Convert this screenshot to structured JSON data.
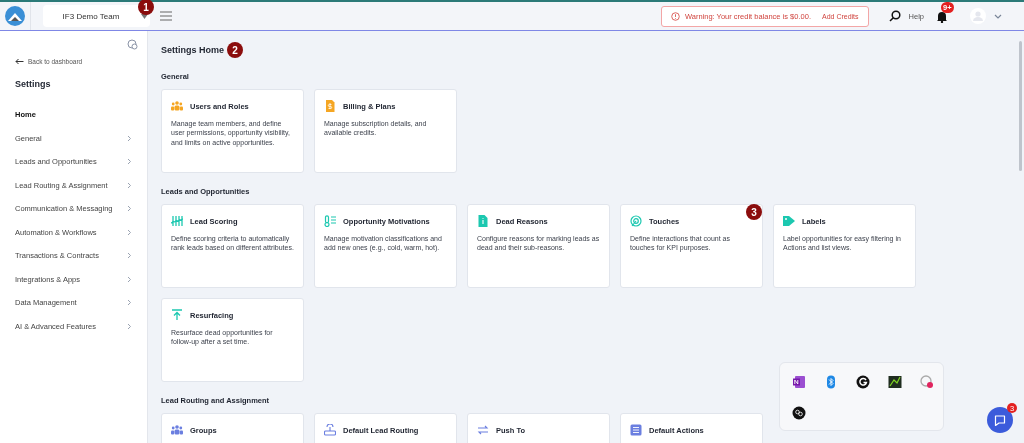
{
  "topbar": {
    "team": "IF3 Demo Team",
    "warning": "Warning: Your credit balance is $0.00.",
    "warning_action": "Add Credits",
    "help": "Help",
    "notification_count": "9+"
  },
  "sidebar": {
    "back": "Back to dashboard",
    "title": "Settings",
    "items": [
      {
        "label": "Home",
        "kind": "link",
        "selected": true
      },
      {
        "label": "General",
        "kind": "group",
        "selected": false
      },
      {
        "label": "Leads and Opportunities",
        "kind": "group",
        "selected": false
      },
      {
        "label": "Lead Routing & Assignment",
        "kind": "group",
        "selected": false
      },
      {
        "label": "Communication & Messaging",
        "kind": "group",
        "selected": false
      },
      {
        "label": "Automation & Workflows",
        "kind": "group",
        "selected": false
      },
      {
        "label": "Transactions & Contracts",
        "kind": "group",
        "selected": false
      },
      {
        "label": "Integrations & Apps",
        "kind": "group",
        "selected": false
      },
      {
        "label": "Data Management",
        "kind": "group",
        "selected": false
      },
      {
        "label": "AI & Advanced Features",
        "kind": "group",
        "selected": false
      }
    ]
  },
  "page_title": "Settings Home",
  "sections": [
    {
      "title": "General",
      "color": "#f5a623",
      "cards": [
        {
          "title": "Users and Roles",
          "kind": "users",
          "description": "Manage team members, and define user permissions, opportunity visibility, and limits on active opportunities."
        },
        {
          "title": "Billing & Plans",
          "kind": "bill",
          "description": "Manage subscription details, and available credits."
        }
      ]
    },
    {
      "title": "Leads and Opportunities",
      "color": "#1cc8b0",
      "cards": [
        {
          "title": "Lead Scoring",
          "kind": "tally",
          "description": "Define scoring criteria to automatically rank leads based on different attributes."
        },
        {
          "title": "Opportunity Motivations",
          "kind": "thermo",
          "description": "Manage motivation classifications and add new ones (e.g., cold, warm, hot)."
        },
        {
          "title": "Dead Reasons",
          "kind": "doc",
          "description": "Configure reasons for marking leads as dead and their sub-reasons."
        },
        {
          "title": "Touches",
          "kind": "touch",
          "description": "Define interactions that count as touches for KPI purposes."
        },
        {
          "title": "Labels",
          "kind": "tag",
          "description": "Label opportunities for easy filtering in Actions and list views."
        },
        {
          "title": "Resurfacing",
          "kind": "up",
          "description": "Resurface dead opportunities for follow-up after a set time."
        }
      ]
    },
    {
      "title": "Lead Routing and Assignment",
      "color": "#6b7fe0",
      "cards": [
        {
          "title": "Groups",
          "kind": "users"
        },
        {
          "title": "Default Lead Routing",
          "kind": "router"
        },
        {
          "title": "Push To",
          "kind": "swap"
        },
        {
          "title": "Default Actions",
          "kind": "list"
        }
      ]
    }
  ],
  "annotations": [
    "1",
    "2",
    "3"
  ],
  "chat_badge": "3"
}
